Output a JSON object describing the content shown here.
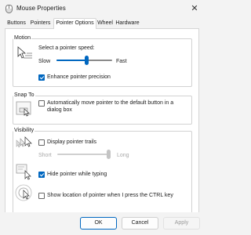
{
  "window": {
    "title": "Mouse Properties",
    "close_glyph": "✕"
  },
  "tabs": [
    {
      "label": "Buttons"
    },
    {
      "label": "Pointers"
    },
    {
      "label": "Pointer Options"
    },
    {
      "label": "Wheel"
    },
    {
      "label": "Hardware"
    }
  ],
  "active_tab": "Pointer Options",
  "motion": {
    "title": "Motion",
    "prompt": "Select a pointer speed:",
    "slow_label": "Slow",
    "fast_label": "Fast",
    "speed_fraction": 0.55,
    "enhance_label": "Enhance pointer precision",
    "enhance_checked": true,
    "icon": "pointer-speed-icon"
  },
  "snap_to": {
    "title": "Snap To",
    "label": "Automatically move pointer to the default button in a dialog box",
    "checked": false,
    "icon": "snap-to-icon"
  },
  "visibility": {
    "title": "Visibility",
    "trails_label": "Display pointer trails",
    "trails_checked": false,
    "short_label": "Short",
    "long_label": "Long",
    "trails_fraction": 1.0,
    "hide_label": "Hide pointer while typing",
    "hide_checked": true,
    "ctrl_label": "Show location of pointer when I press the CTRL key",
    "ctrl_checked": false,
    "icons": [
      "pointer-trails-icon",
      "hide-pointer-icon",
      "show-location-icon"
    ]
  },
  "buttons": {
    "ok": "OK",
    "cancel": "Cancel",
    "apply": "Apply"
  },
  "colors": {
    "accent": "#0067c0",
    "window_bg": "#f3f3f3",
    "panel_bg": "#ffffff",
    "border": "#d2d2d2"
  }
}
